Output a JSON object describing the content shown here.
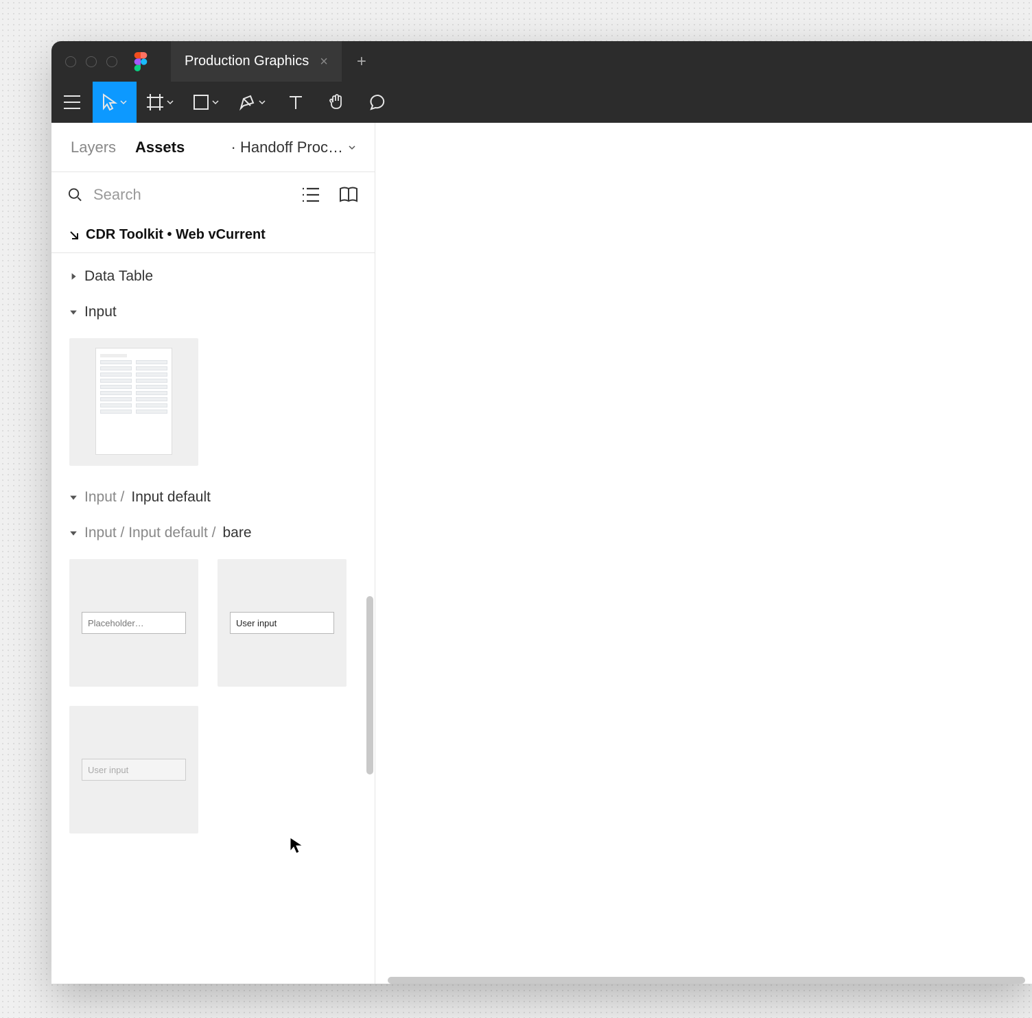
{
  "window": {
    "tab_title": "Production Graphics"
  },
  "sidebar": {
    "tabs": {
      "layers": "Layers",
      "assets": "Assets"
    },
    "page_label": "· Handoff Proc…",
    "search_placeholder": "Search",
    "library_name": "CDR Toolkit • Web vCurrent",
    "tree": {
      "data_table": "Data Table",
      "input": "Input",
      "input_default_prefix": "Input / ",
      "input_default": "Input default",
      "bare_prefix": "Input / Input default / ",
      "bare": "bare"
    },
    "components": {
      "placeholder": "Placeholder…",
      "user_input": "User input",
      "disabled_input": "User input"
    }
  }
}
